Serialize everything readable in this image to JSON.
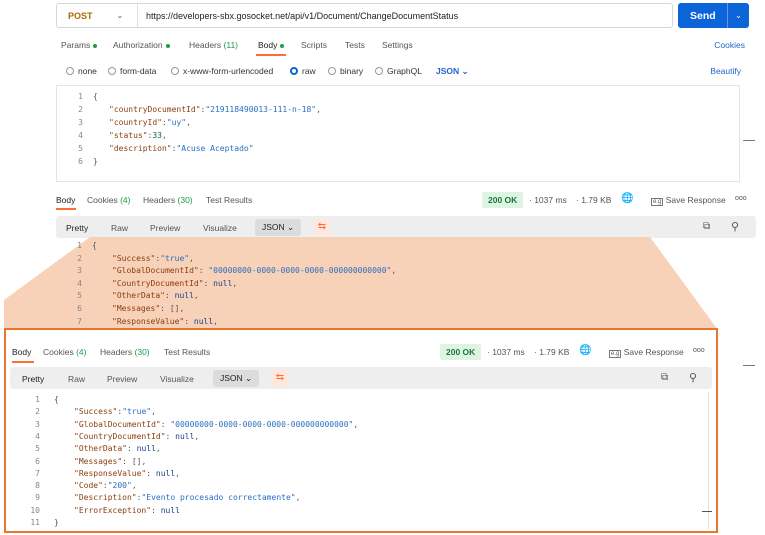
{
  "request": {
    "method": "POST",
    "url": "https://developers-sbx.gosocket.net/api/v1/Document/ChangeDocumentStatus",
    "send_label": "Send",
    "tabs": {
      "params": "Params",
      "authorization": "Authorization",
      "headers": "Headers",
      "headers_count": "(11)",
      "body": "Body",
      "scripts": "Scripts",
      "tests": "Tests",
      "settings": "Settings"
    },
    "cookies_link": "Cookies",
    "body_types": [
      "none",
      "form-data",
      "x-www-form-urlencoded",
      "raw",
      "binary",
      "GraphQL"
    ],
    "selected_body_type": "raw",
    "format": "JSON",
    "beautify_label": "Beautify",
    "body_lines": [
      {
        "n": "1",
        "text": "{"
      },
      {
        "n": "2",
        "key": "\"countryDocumentId\"",
        "sep": ":",
        "val": "\"219118490013-111-n-18\"",
        "vtype": "str",
        "end": ","
      },
      {
        "n": "3",
        "key": "\"countryId\"",
        "sep": ":",
        "val": "\"uy\"",
        "vtype": "str",
        "end": ","
      },
      {
        "n": "4",
        "key": "\"status\"",
        "sep": ":",
        "val": "33",
        "vtype": "num",
        "end": ","
      },
      {
        "n": "5",
        "key": "\"description\"",
        "sep": ":",
        "val": "\"Acuse Aceptado\"",
        "vtype": "str",
        "end": ""
      },
      {
        "n": "6",
        "text": "}"
      }
    ]
  },
  "response": {
    "tabs": {
      "body": "Body",
      "cookies": "Cookies",
      "cookies_count": "(4)",
      "headers": "Headers",
      "headers_count": "(30)",
      "test_results": "Test Results"
    },
    "status": "200 OK",
    "time": "1037 ms",
    "size": "1.79 KB",
    "save_label": "Save Response",
    "more": "ooo",
    "views": [
      "Pretty",
      "Raw",
      "Preview",
      "Visualize"
    ],
    "format": "JSON",
    "lines": [
      {
        "n": "1",
        "text": "{"
      },
      {
        "n": "2",
        "key": "\"Success\"",
        "sep": ":",
        "val": "\"true\"",
        "vtype": "str",
        "end": ",",
        "hl": true
      },
      {
        "n": "3",
        "key": "\"GlobalDocumentId\"",
        "sep": ": ",
        "val": "\"00000000-0000-0000-0000-000000000000\"",
        "vtype": "str",
        "end": ","
      },
      {
        "n": "4",
        "key": "\"CountryDocumentId\"",
        "sep": ": ",
        "val": "null",
        "vtype": "kw",
        "end": ","
      },
      {
        "n": "5",
        "key": "\"OtherData\"",
        "sep": ": ",
        "val": "null",
        "vtype": "kw",
        "end": ","
      },
      {
        "n": "6",
        "key": "\"Messages\"",
        "sep": ": ",
        "val": "[]",
        "vtype": "punc",
        "end": ","
      },
      {
        "n": "7",
        "key": "\"ResponseValue\"",
        "sep": ": ",
        "val": "null",
        "vtype": "kw",
        "end": ","
      },
      {
        "n": "8",
        "key": "\"Code\"",
        "sep": ":",
        "val": "\"200\"",
        "vtype": "str",
        "end": ",",
        "hl": true
      },
      {
        "n": "9",
        "key": "\"Description\"",
        "sep": ":",
        "val": "\"Evento procesado correctamente\"",
        "vtype": "str",
        "end": ",",
        "hl": true
      },
      {
        "n": "10",
        "key": "\"ErrorException\"",
        "sep": ": ",
        "val": "null",
        "vtype": "kw",
        "end": ""
      },
      {
        "n": "11",
        "text": "}"
      }
    ]
  },
  "colors": {
    "accent": "#ff6c37",
    "send": "#0b65d8",
    "status_ok": "#1a7a3a",
    "highlight": "#f7c5a7",
    "zoom_border": "#e8772e"
  }
}
